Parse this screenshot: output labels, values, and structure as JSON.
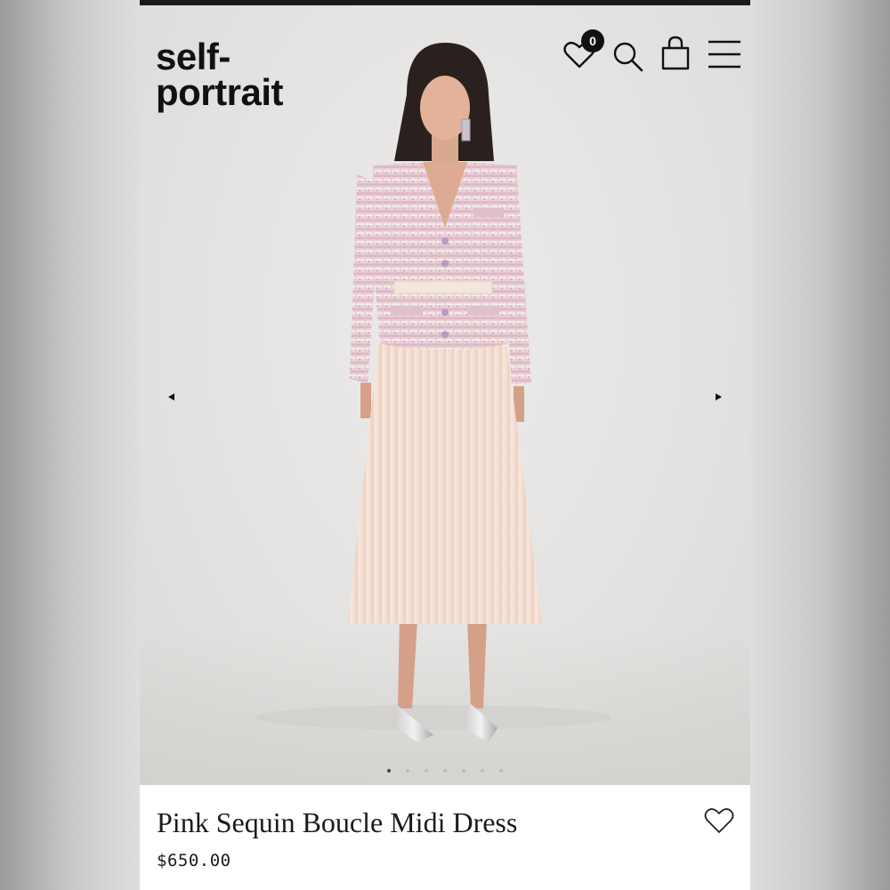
{
  "brand": {
    "line1": "self-",
    "line2": "portrait"
  },
  "header": {
    "wishlist_count": "0",
    "icons": [
      "heart-icon",
      "search-icon",
      "bag-icon",
      "menu-icon"
    ]
  },
  "gallery": {
    "image_alt": "Model wearing pink sequin boucle jacket with cream pleated midi skirt",
    "slide_count": 7,
    "active_slide": 1,
    "prev_icon": "triangle-left-icon",
    "next_icon": "triangle-right-icon"
  },
  "product": {
    "name": "Pink Sequin Boucle Midi Dress",
    "price": "$650.00"
  },
  "colors": {
    "accent": "#111111",
    "jacket_pink": "#e8c9d0",
    "skirt_cream": "#f3dccf"
  }
}
